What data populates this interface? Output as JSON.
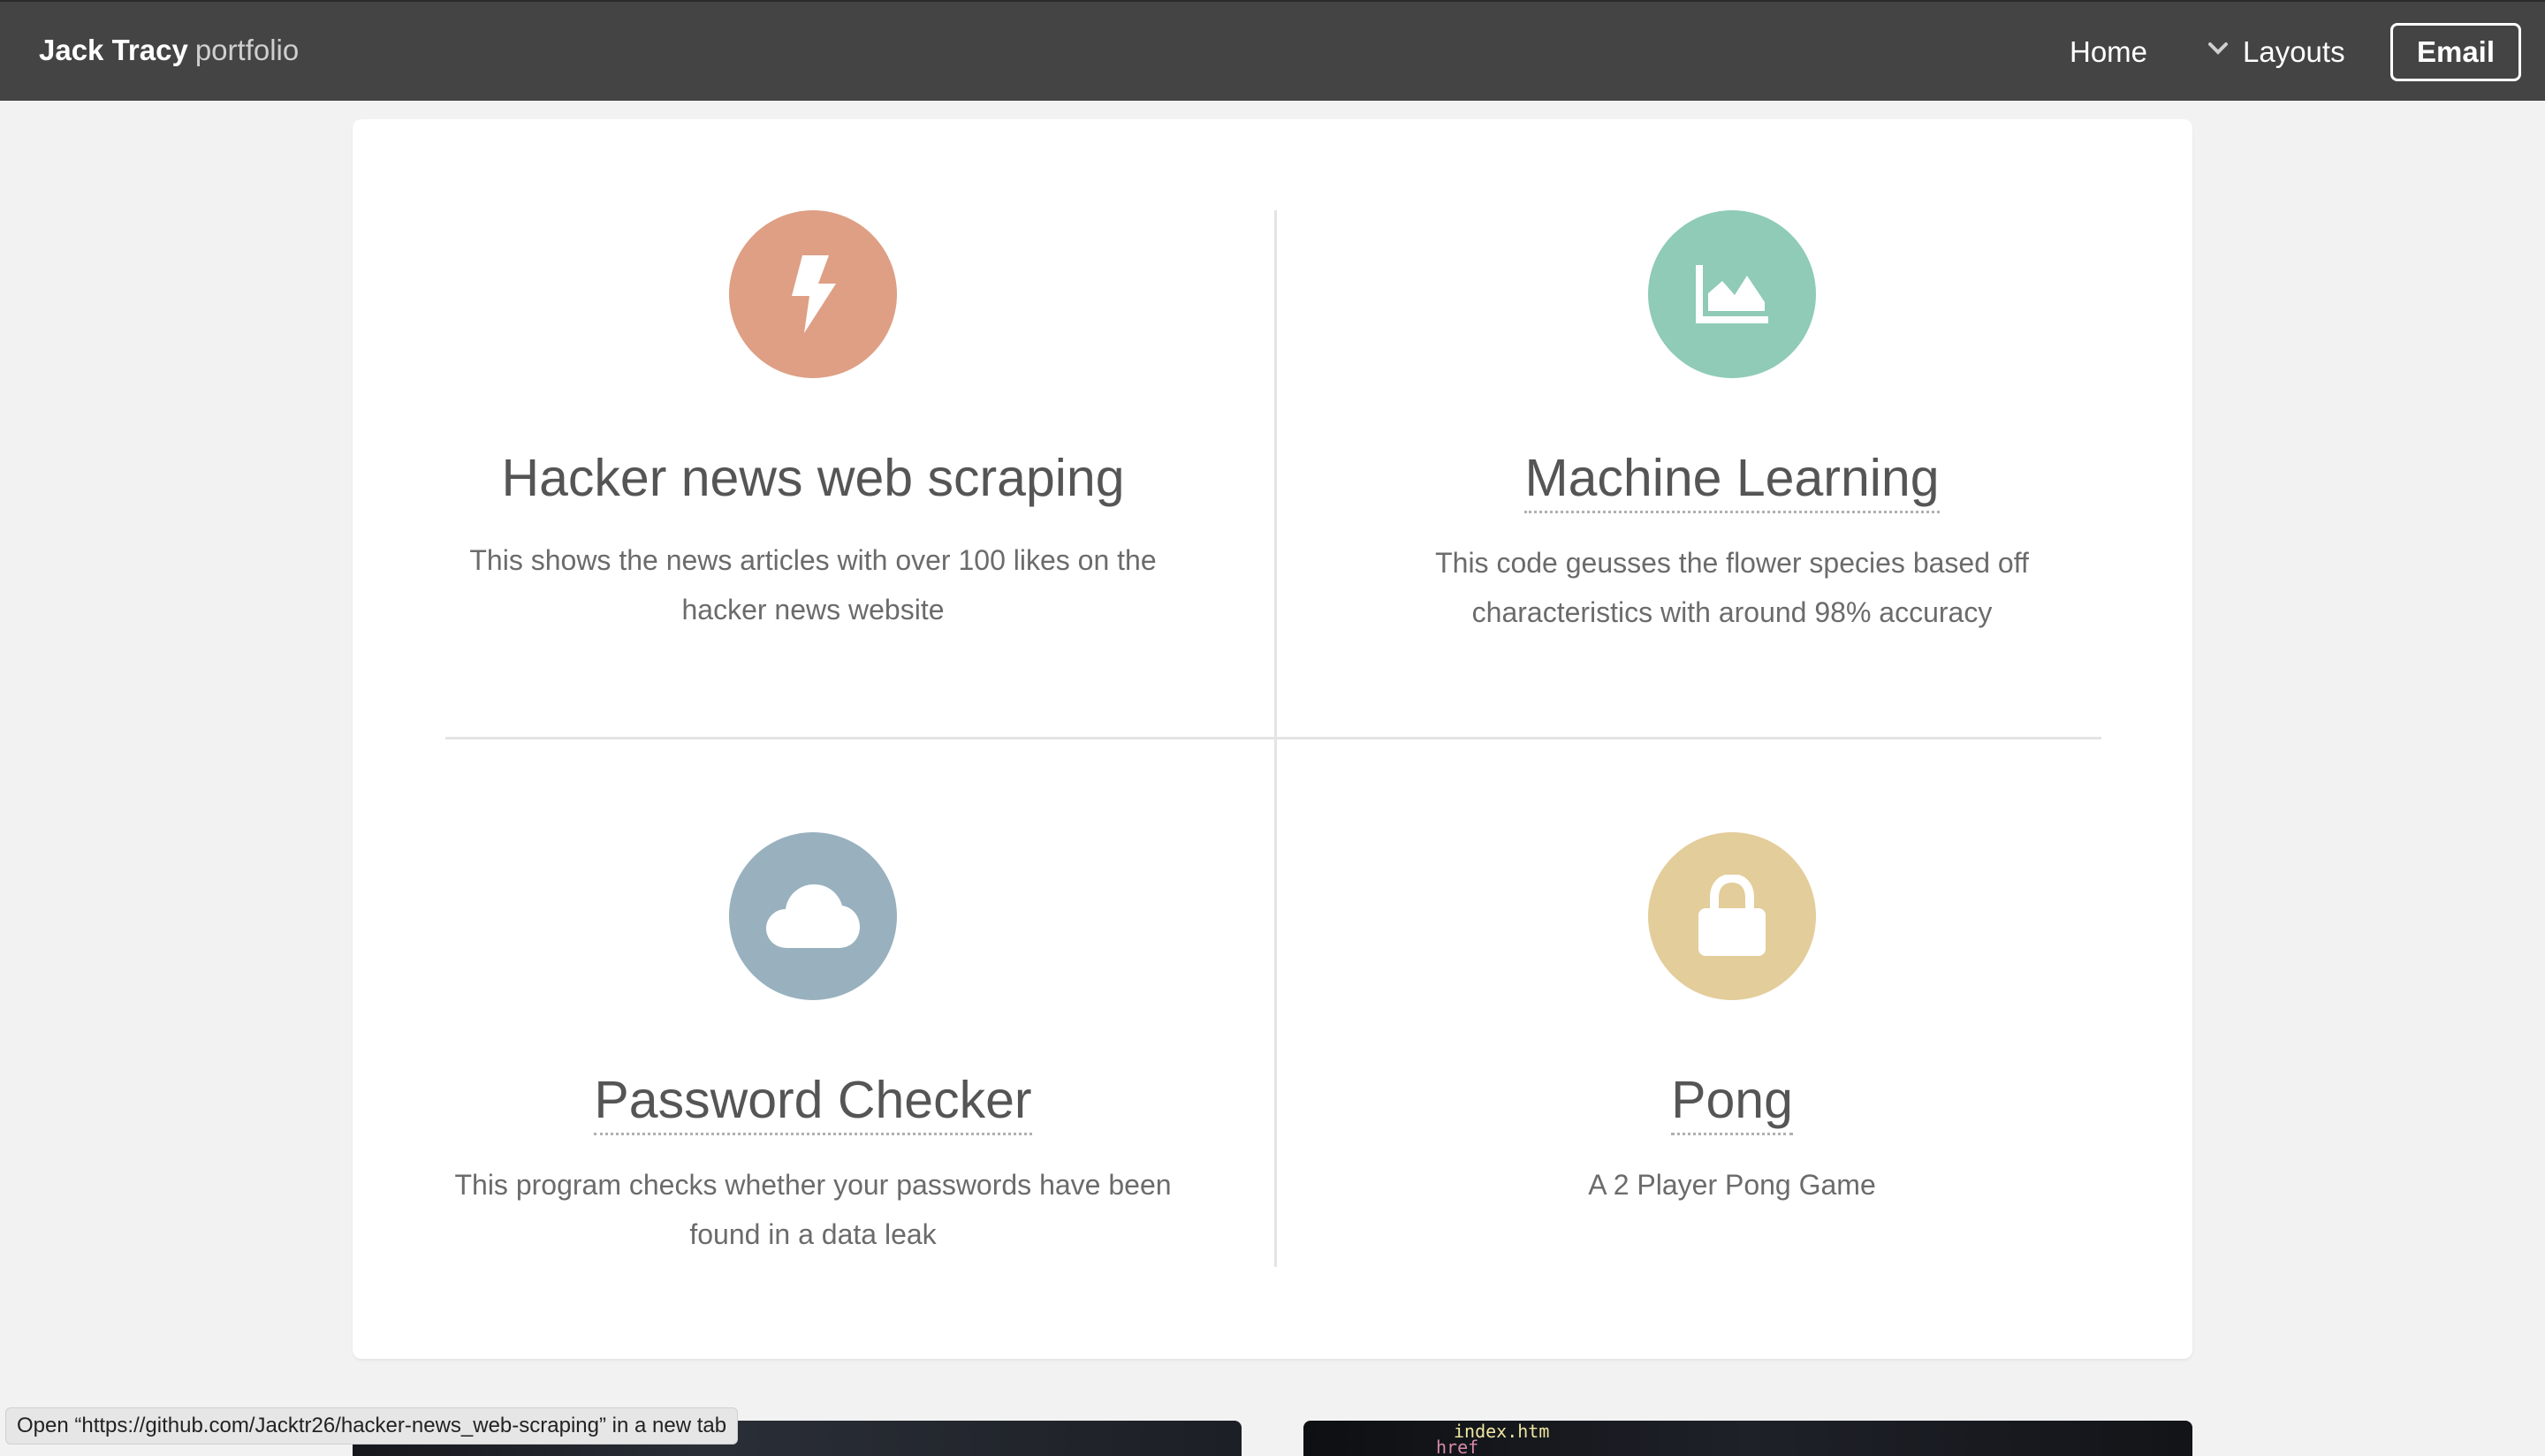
{
  "navbar": {
    "brand_name": "Jack Tracy",
    "brand_sub": "portfolio",
    "home_label": "Home",
    "layouts_label": "Layouts",
    "email_label": "Email"
  },
  "features": [
    {
      "title": "Hacker news web scraping",
      "description": "This shows the news articles with over 100 likes on the hacker news website",
      "icon": "bolt-icon",
      "color": "#de9f85"
    },
    {
      "title": "Machine Learning",
      "description": "This code geusses the flower species based off characteristics with around 98% accuracy",
      "icon": "area-chart-icon",
      "color": "#8fcbb7"
    },
    {
      "title": "Password Checker",
      "description": "This program checks whether your passwords have been found in a data leak",
      "icon": "cloud-icon",
      "color": "#99b1be"
    },
    {
      "title": "Pong",
      "description": "A 2 Player Pong Game",
      "icon": "lock-icon",
      "color": "#e3cd9a"
    }
  ],
  "status_bar": {
    "text": "Open “https://github.com/Jacktr26/hacker-news_web-scraping” in a new tab"
  },
  "thumbnail_right": {
    "code_line_1": "index.htm",
    "code_line_2": "href"
  }
}
